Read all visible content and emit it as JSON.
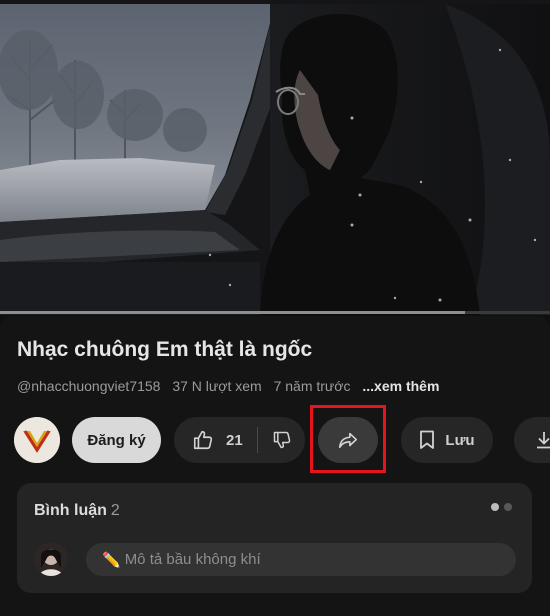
{
  "video": {
    "progress_fraction": 0.845
  },
  "title": "Nhạc chuông Em thật là ngốc",
  "meta": {
    "channel_handle": "@nhacchuongviet7158",
    "views": "37 N lượt xem",
    "age": "7 năm trước",
    "more_label": "...xem thêm"
  },
  "actions": {
    "subscribe_label": "Đăng ký",
    "like_count": "21",
    "save_label": "Lưu"
  },
  "comments": {
    "header": "Bình luận",
    "count": "2",
    "input_placeholder": "Mô tả bầu không khí",
    "pencil_glyph": "✏️"
  },
  "colors": {
    "highlight": "#e8141c",
    "background": "#0f0f0f",
    "chip": "#262626"
  },
  "icons": [
    "thumbs-up-icon",
    "thumbs-down-icon",
    "share-icon",
    "bookmark-icon",
    "download-icon"
  ]
}
